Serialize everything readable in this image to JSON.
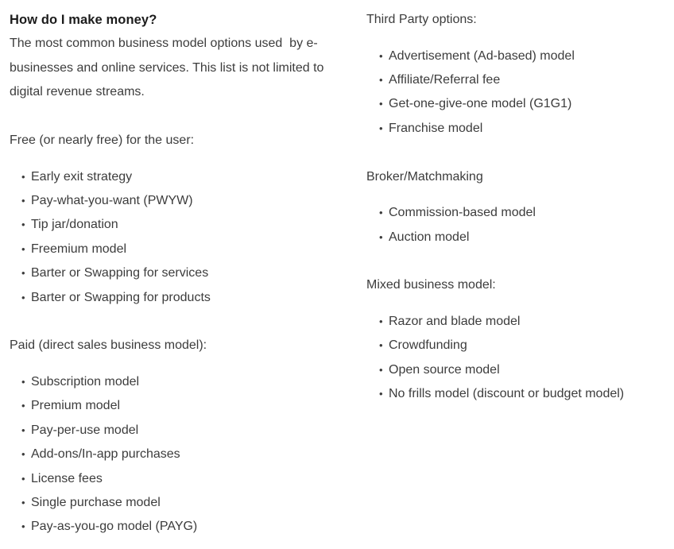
{
  "document": {
    "title": "How do I make money?",
    "intro": "The most common business model options used  by e-businesses and online services. This list is not limited to digital revenue streams.",
    "bullet_glyph": "•",
    "text_color": "#3c3c3c",
    "title_color": "#1c1c1c",
    "background_color": "#ffffff"
  },
  "left_column": {
    "sections": [
      {
        "heading": "Free (or nearly free) for the user:",
        "items": [
          "Early exit strategy",
          "Pay-what-you-want (PWYW)",
          "Tip jar/donation",
          "Freemium model",
          "Barter or Swapping for services",
          "Barter or Swapping for products"
        ]
      },
      {
        "heading": "Paid (direct sales business model):",
        "items": [
          "Subscription model",
          "Premium model",
          "Pay-per-use model",
          "Add-ons/In-app purchases",
          "License fees",
          "Single purchase model",
          "Pay-as-you-go model (PAYG)"
        ]
      }
    ]
  },
  "right_column": {
    "sections": [
      {
        "heading": "Third Party options:",
        "items": [
          "Advertisement (Ad-based) model",
          "Affiliate/Referral fee",
          "Get-one-give-one model (G1G1)",
          "Franchise model"
        ]
      },
      {
        "heading": "Broker/Matchmaking",
        "items": [
          "Commission-based model",
          "Auction model"
        ]
      },
      {
        "heading": "Mixed business model:",
        "items": [
          "Razor and blade model",
          "Crowdfunding",
          "Open source model",
          "No frills model (discount or budget model)"
        ]
      }
    ]
  }
}
